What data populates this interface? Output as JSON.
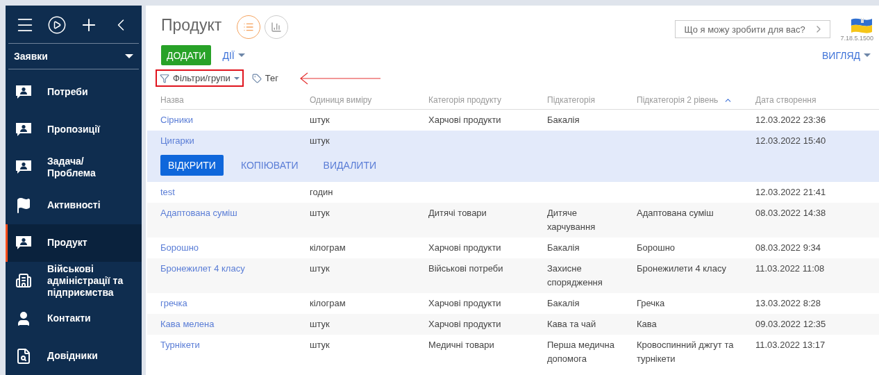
{
  "sidebar": {
    "section": {
      "label": "Заявки"
    },
    "items": [
      {
        "label": "Потреби",
        "kind": "request",
        "selected": false
      },
      {
        "label": "Пропозиції",
        "kind": "request",
        "selected": false
      },
      {
        "label": "Задача/ Проблема",
        "kind": "request",
        "selected": false
      },
      {
        "label": "Активності",
        "kind": "activity",
        "selected": false
      },
      {
        "label": "Продукт",
        "kind": "request",
        "selected": true
      },
      {
        "label": "Військові адміністрації та підприємства",
        "kind": "organization",
        "selected": false
      },
      {
        "label": "Контакти",
        "kind": "contact",
        "selected": false
      },
      {
        "label": "Довідники",
        "kind": "lookup",
        "selected": false
      }
    ]
  },
  "header": {
    "title": "Продукт",
    "views": [
      {
        "kind": "list",
        "selected": true
      },
      {
        "kind": "chart",
        "selected": false
      }
    ],
    "search": {
      "placeholder": "Що я можу зробити для вас?"
    },
    "version": "7.18.5.1500"
  },
  "toolbar": {
    "add_button": "ДОДАТИ",
    "actions_menu": "ДІЇ",
    "view_menu": "ВИГЛЯД"
  },
  "filters": [
    {
      "kind": "filter",
      "label": "Фільтри/групи",
      "highlighted": true
    },
    {
      "kind": "tag",
      "label": "Тег",
      "highlighted": false
    }
  ],
  "annotation": {
    "kind": "arrow"
  },
  "table": {
    "columns": [
      {
        "label": "Назва",
        "sorted": false
      },
      {
        "label": "Одиниця виміру",
        "sorted": false
      },
      {
        "label": "Категорія продукту",
        "sorted": false
      },
      {
        "label": "Підкатегорія",
        "sorted": false
      },
      {
        "label": "Підкатегорія 2 рівень",
        "sorted": true
      },
      {
        "label": "Дата створення",
        "sorted": false
      }
    ],
    "rows": [
      {
        "cells": [
          "Сірники",
          "штук",
          "Харчові продукти",
          "Бакалія",
          "",
          "12.03.2022 23:36"
        ],
        "selected": false
      },
      {
        "cells": [
          "Цигарки",
          "штук",
          "",
          "",
          "",
          "12.03.2022 15:40"
        ],
        "selected": true,
        "actions": [
          {
            "label": "ВІДКРИТИ",
            "primary": true
          },
          {
            "label": "КОПІЮВАТИ",
            "primary": false
          },
          {
            "label": "ВИДАЛИТИ",
            "primary": false
          }
        ]
      },
      {
        "cells": [
          "test",
          "годин",
          "",
          "",
          "",
          "12.03.2022 21:41"
        ],
        "selected": false
      },
      {
        "cells": [
          "Адаптована суміш",
          "штук",
          "Дитячі товари",
          "Дитяче харчування",
          "Адаптована суміш",
          "08.03.2022 14:38"
        ],
        "selected": false
      },
      {
        "cells": [
          "Борошно",
          "кілограм",
          "Харчові продукти",
          "Бакалія",
          "Борошно",
          "08.03.2022 9:34"
        ],
        "selected": false
      },
      {
        "cells": [
          "Бронежилет 4 класу",
          "штук",
          "Військові потреби",
          "Захисне спорядження",
          "Бронежилети 4 класу",
          "11.03.2022 11:08"
        ],
        "selected": false
      },
      {
        "cells": [
          "гречка",
          "кілограм",
          "Харчові продукти",
          "Бакалія",
          "Гречка",
          "13.03.2022 8:28"
        ],
        "selected": false
      },
      {
        "cells": [
          "Кава мелена",
          "штук",
          "Харчові продукти",
          "Кава та чай",
          "Кава",
          "09.03.2022 12:35"
        ],
        "selected": false
      },
      {
        "cells": [
          "Турнікети",
          "штук",
          "Медичні товари",
          "Перша медична допомога",
          "Кровоспинний джгут та турнікети",
          "11.03.2022 13:17"
        ],
        "selected": false
      }
    ]
  }
}
